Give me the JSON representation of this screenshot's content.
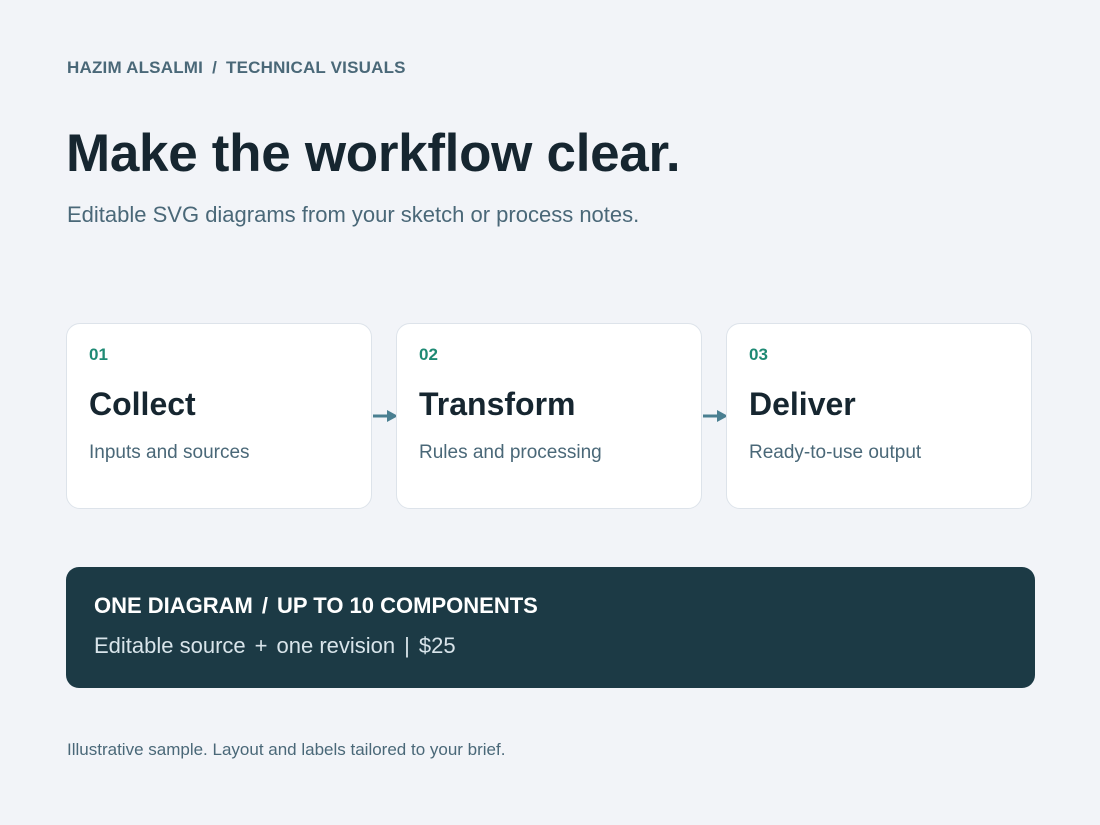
{
  "header": {
    "author": "HAZIM ALSALMI",
    "separator": "/",
    "section": "TECHNICAL VISUALS"
  },
  "hero": {
    "headline": "Make the workflow clear.",
    "subhead": "Editable SVG diagrams from your sketch or process notes."
  },
  "steps": [
    {
      "number": "01",
      "title": "Collect",
      "description": "Inputs and sources"
    },
    {
      "number": "02",
      "title": "Transform",
      "description": "Rules and processing"
    },
    {
      "number": "03",
      "title": "Deliver",
      "description": "Ready-to-use output"
    }
  ],
  "offer": {
    "title_left": "ONE DIAGRAM",
    "title_sep": "/",
    "title_right": "UP TO 10 COMPONENTS",
    "detail_source": "Editable source",
    "detail_plus": "+",
    "detail_revision": "one revision",
    "detail_sep": "|",
    "price": "$25"
  },
  "footnote": "Illustrative sample. Layout and labels tailored to your brief.",
  "colors": {
    "background": "#f2f4f8",
    "heading": "#162630",
    "muted": "#4a6878",
    "accent": "#1f8a74",
    "arrow": "#4a7f91",
    "banner": "#1c3a45"
  },
  "icons": {
    "connector": "arrow-right-icon"
  }
}
